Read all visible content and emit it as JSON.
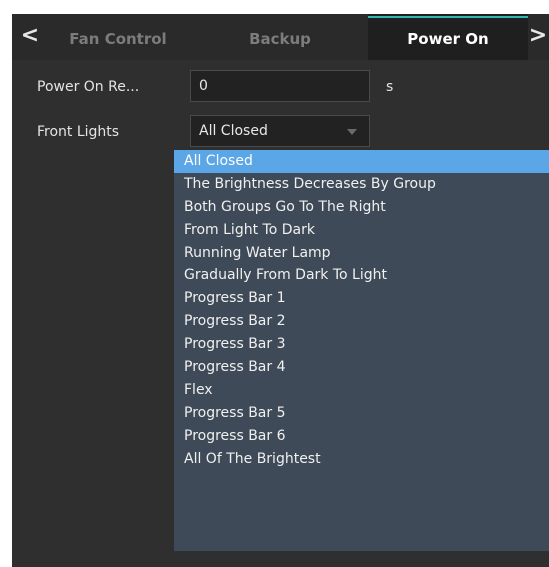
{
  "tabs": {
    "prev_arrow": "<",
    "next_arrow": ">",
    "items": [
      {
        "label": "Fan Control"
      },
      {
        "label": "Backup"
      },
      {
        "label": "Power On"
      }
    ]
  },
  "form": {
    "power_on_label": "Power On Re...",
    "power_on_value": "0",
    "power_on_unit": "s",
    "front_lights_label": "Front Lights",
    "front_lights_value": "All Closed"
  },
  "dropdown": {
    "options": [
      "All Closed",
      "The Brightness Decreases By Group",
      "Both Groups Go To The Right",
      "From Light To Dark",
      "Running Water Lamp",
      "Gradually From Dark To Light",
      "Progress Bar 1",
      "Progress Bar 2",
      "Progress Bar 3",
      "Progress Bar 4",
      "Flex",
      "Progress Bar 5",
      "Progress Bar 6",
      "All Of The Brightest"
    ],
    "selected_index": 0
  },
  "colors": {
    "accent": "#2fb8b0",
    "selection": "#5aa6e6",
    "background": "#2f2f2f"
  }
}
